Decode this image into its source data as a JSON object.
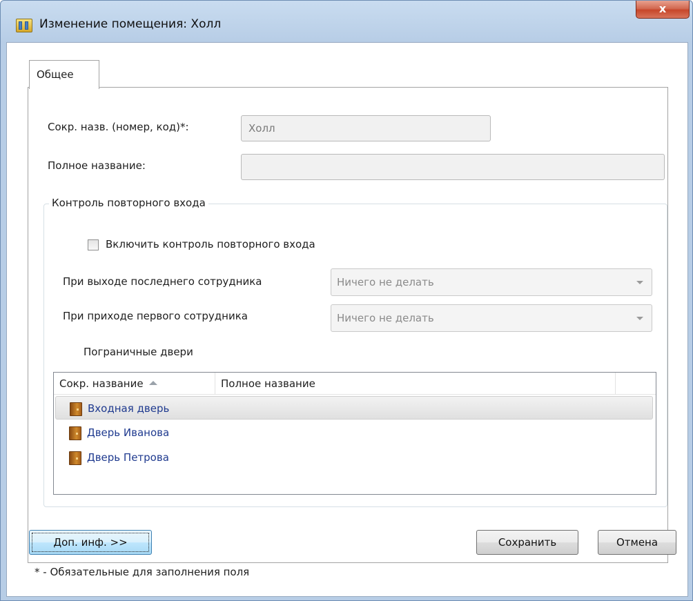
{
  "window": {
    "title": "Изменение помещения: Холл",
    "close_glyph": "x"
  },
  "tabs": [
    {
      "label": "Общее",
      "selected": true
    }
  ],
  "form": {
    "short_name_label": "Сокр. назв. (номер, код)*:",
    "short_name_value": "Холл",
    "full_name_label": "Полное название:",
    "full_name_value": ""
  },
  "reentry_group": {
    "title": "Контроль повторного входа",
    "enable_checkbox_label": "Включить контроль повторного входа",
    "enable_checked": false,
    "last_exit_label": "При выходе последнего сотрудника",
    "last_exit_value": "Ничего не делать",
    "first_arrival_label": "При приходе первого сотрудника",
    "first_arrival_value": "Ничего не делать",
    "border_doors_label": "Пограничные двери",
    "doors_table": {
      "columns": [
        "Сокр. название",
        "Полное название"
      ],
      "sort_column": "Сокр. название",
      "sort_direction": "ascending",
      "rows": [
        {
          "short_name": "Входная дверь",
          "full_name": "",
          "icon": "door-icon",
          "selected": true
        },
        {
          "short_name": "Дверь Иванова",
          "full_name": "",
          "icon": "door-icon",
          "selected": false
        },
        {
          "short_name": "Дверь Петрова",
          "full_name": "",
          "icon": "door-icon",
          "selected": false
        }
      ]
    }
  },
  "buttons": {
    "more_info": "Доп. инф. >>",
    "save": "Сохранить",
    "cancel": "Отмена"
  },
  "footnote": "* - Обязательные для заполнения поля",
  "colors": {
    "titlebar": "#b7cde6",
    "close_button": "#c7472b",
    "list_text": "#1f3a8f"
  }
}
